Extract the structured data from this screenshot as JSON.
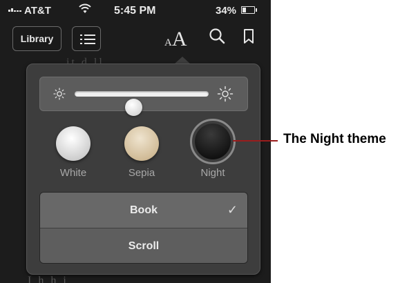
{
  "status_bar": {
    "carrier": "AT&T",
    "time": "5:45 PM",
    "battery": "34%",
    "battery_level": 0.34
  },
  "toolbar": {
    "library_label": "Library",
    "font_small": "A",
    "font_large": "A",
    "icons": [
      "list-icon",
      "search-icon",
      "bookmark-icon"
    ]
  },
  "background_text": {
    "top": "it      d      ll",
    "bottom": "I                  h   h    i"
  },
  "popover": {
    "brightness": {
      "level": 0.44,
      "icons": [
        "sun-small-icon",
        "sun-large-icon"
      ]
    },
    "themes": [
      {
        "label": "White",
        "color": "#e6e6e6"
      },
      {
        "label": "Sepia",
        "color": "#d6c29e"
      },
      {
        "label": "Night",
        "color": "#1a1a1a",
        "selected": true
      }
    ],
    "layout_options": [
      {
        "label": "Book",
        "selected": true
      },
      {
        "label": "Scroll",
        "selected": false
      }
    ],
    "checkmark": "✓"
  },
  "callout": {
    "text": "The Night theme",
    "color": "#9a1c1c"
  }
}
